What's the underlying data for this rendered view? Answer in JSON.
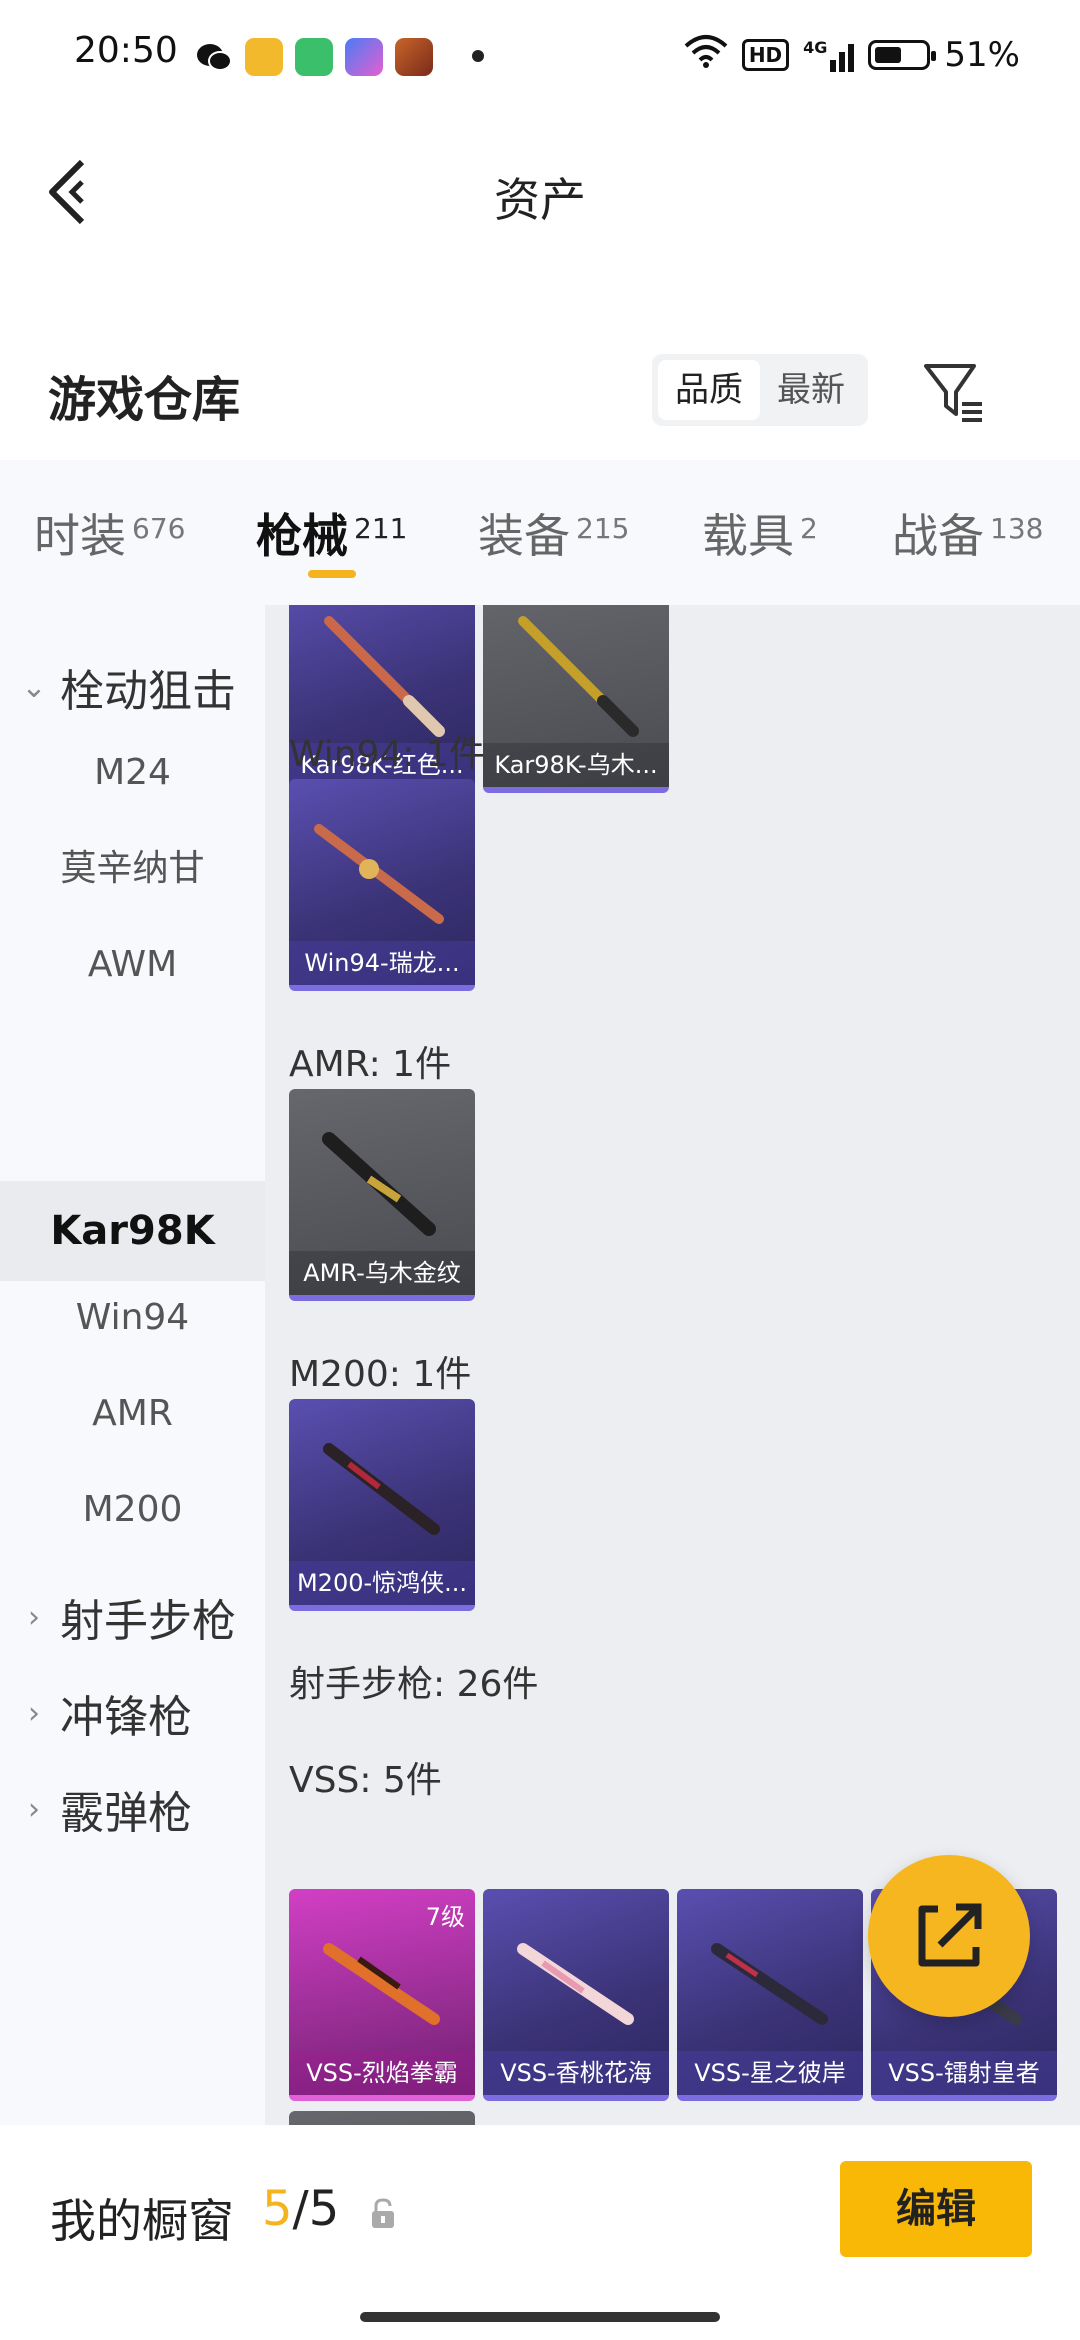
{
  "status_bar": {
    "time": "20:50",
    "hd": "HD",
    "network": "4G",
    "battery_percent": "51%",
    "battery_level": 0.51
  },
  "header": {
    "title": "资产",
    "back_icon": "chevron-left-icon"
  },
  "repo": {
    "title": "游戏仓库",
    "sort_options": [
      "品质",
      "最新"
    ],
    "sort_selected": "品质",
    "filter_icon": "filter-icon"
  },
  "tabs": [
    {
      "label": "时装",
      "count": "676"
    },
    {
      "label": "枪械",
      "count": "211",
      "active": true
    },
    {
      "label": "装备",
      "count": "215"
    },
    {
      "label": "载具",
      "count": "2"
    },
    {
      "label": "战备",
      "count": "138"
    }
  ],
  "side_nav": {
    "groups": [
      "栓动狙击",
      "射手步枪",
      "冲锋枪",
      "霰弹枪"
    ],
    "items": [
      "M24",
      "莫辛纳甘",
      "AWM",
      "Kar98K",
      "Win94",
      "AMR",
      "M200"
    ],
    "active_item": "Kar98K"
  },
  "content": {
    "kar98k_cards": [
      "Kar98K-红色...",
      "Kar98K-乌木..."
    ],
    "win94_label": "Win94: 1件",
    "win94_cards": [
      "Win94-瑞龙..."
    ],
    "amr_label": "AMR: 1件",
    "amr_cards": [
      "AMR-乌木金纹"
    ],
    "m200_label": "M200: 1件",
    "m200_cards": [
      "M200-惊鸿侠..."
    ],
    "marksman_label": "射手步枪: 26件",
    "vss_label": "VSS: 5件",
    "vss_cards": [
      "VSS-烈焰拳霸",
      "VSS-香桃花海",
      "VSS-星之彼岸",
      "VSS-镭射皇者"
    ],
    "vss_first_level": "7级"
  },
  "fab": {
    "icon": "share-icon"
  },
  "bottom_bar": {
    "showcase_label": "我的橱窗",
    "showcase_current": "5",
    "showcase_sep": "/",
    "showcase_total": "5",
    "lock_icon": "lock-icon",
    "edit_label": "编辑"
  },
  "colors": {
    "accent": "#f5b31e",
    "edit_button": "#f8b805",
    "card_purple": "#3a3275",
    "card_gray": "#4a4b50",
    "card_pink": "#d23fc5"
  }
}
